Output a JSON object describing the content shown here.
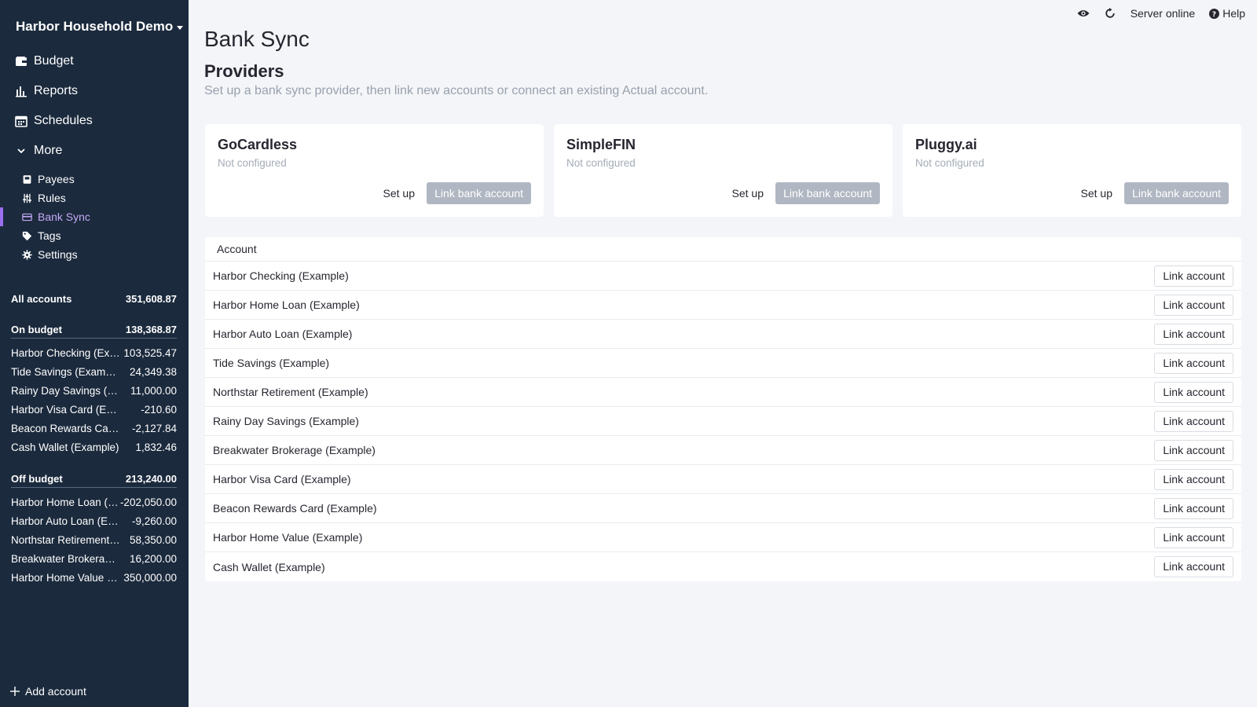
{
  "sidebar": {
    "budget_name": "Harbor Household Demo",
    "nav": [
      {
        "label": "Budget",
        "icon": "wallet-icon"
      },
      {
        "label": "Reports",
        "icon": "bar-chart-icon"
      },
      {
        "label": "Schedules",
        "icon": "calendar-icon"
      },
      {
        "label": "More",
        "icon": "chevron-down-icon"
      }
    ],
    "sub_nav": [
      {
        "label": "Payees",
        "icon": "payee-icon"
      },
      {
        "label": "Rules",
        "icon": "sliders-icon"
      },
      {
        "label": "Bank Sync",
        "icon": "credit-card-icon",
        "active": true
      },
      {
        "label": "Tags",
        "icon": "tag-icon"
      },
      {
        "label": "Settings",
        "icon": "gear-icon"
      }
    ],
    "all_accounts": {
      "label": "All accounts",
      "amount": "351,608.87"
    },
    "on_budget": {
      "label": "On budget",
      "amount": "138,368.87"
    },
    "on_budget_accounts": [
      {
        "name": "Harbor Checking (Example)",
        "amount": "103,525.47"
      },
      {
        "name": "Tide Savings (Example)",
        "amount": "24,349.38"
      },
      {
        "name": "Rainy Day Savings (Example)",
        "amount": "11,000.00"
      },
      {
        "name": "Harbor Visa Card (Example)",
        "amount": "-210.60"
      },
      {
        "name": "Beacon Rewards Card (Example)",
        "amount": "-2,127.84"
      },
      {
        "name": "Cash Wallet (Example)",
        "amount": "1,832.46"
      }
    ],
    "off_budget": {
      "label": "Off budget",
      "amount": "213,240.00"
    },
    "off_budget_accounts": [
      {
        "name": "Harbor Home Loan (Example)",
        "amount": "-202,050.00"
      },
      {
        "name": "Harbor Auto Loan (Example)",
        "amount": "-9,260.00"
      },
      {
        "name": "Northstar Retirement (Example)",
        "amount": "58,350.00"
      },
      {
        "name": "Breakwater Brokerage (Example)",
        "amount": "16,200.00"
      },
      {
        "name": "Harbor Home Value (Example)",
        "amount": "350,000.00"
      }
    ],
    "add_account": "Add account"
  },
  "topbar": {
    "server_status": "Server online",
    "help": "Help"
  },
  "page": {
    "title": "Bank Sync",
    "section_title": "Providers",
    "section_desc": "Set up a bank sync provider, then link new accounts or connect an existing Actual account."
  },
  "providers": [
    {
      "name": "GoCardless",
      "status": "Not configured",
      "setup": "Set up",
      "link": "Link bank account"
    },
    {
      "name": "SimpleFIN",
      "status": "Not configured",
      "setup": "Set up",
      "link": "Link bank account"
    },
    {
      "name": "Pluggy.ai",
      "status": "Not configured",
      "setup": "Set up",
      "link": "Link bank account"
    }
  ],
  "table": {
    "header": "Account",
    "link_label": "Link account",
    "rows": [
      "Harbor Checking (Example)",
      "Harbor Home Loan (Example)",
      "Harbor Auto Loan (Example)",
      "Tide Savings (Example)",
      "Northstar Retirement (Example)",
      "Rainy Day Savings (Example)",
      "Breakwater Brokerage (Example)",
      "Harbor Visa Card (Example)",
      "Beacon Rewards Card (Example)",
      "Harbor Home Value (Example)",
      "Cash Wallet (Example)"
    ]
  }
}
